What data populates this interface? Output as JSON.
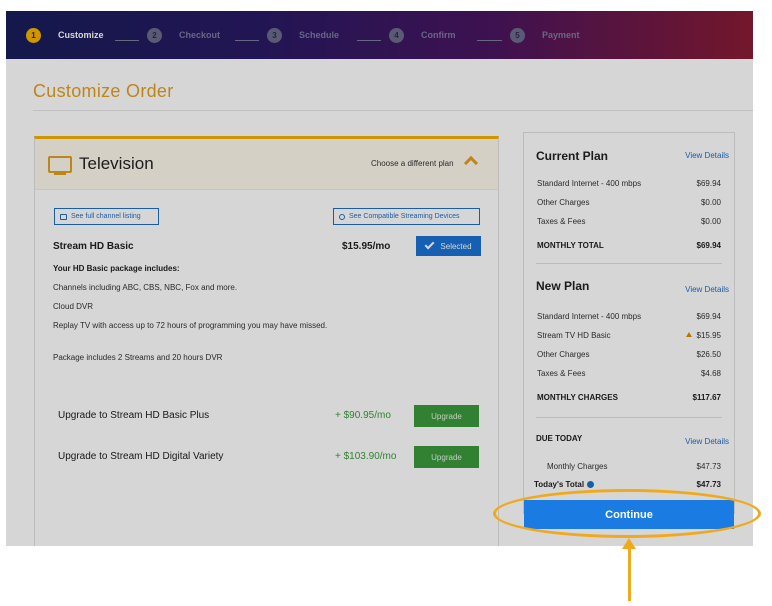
{
  "stepper": {
    "steps": [
      {
        "num": "1",
        "label": "Customize"
      },
      {
        "num": "2",
        "label": "Checkout"
      },
      {
        "num": "3",
        "label": "Schedule"
      },
      {
        "num": "4",
        "label": "Confirm"
      },
      {
        "num": "5",
        "label": "Payment"
      }
    ]
  },
  "page_title": "Customize Order",
  "television": {
    "title": "Television",
    "change_plan_label": "Choose a different plan",
    "channel_listing_label": "See full channel listing",
    "devices_label": "See Compatible Streaming Devices",
    "plan_name": "Stream HD Basic",
    "plan_price": "$15.95/mo",
    "selected_label": "Selected",
    "includes_title": "Your HD Basic package includes:",
    "includes": [
      "Channels including ABC, CBS, NBC, Fox and more.",
      "Cloud DVR",
      "Replay TV with access up to 72 hours of programming you may have missed.",
      "Package includes 2 Streams and 20 hours DVR"
    ],
    "upgrades": [
      {
        "name": "Upgrade to Stream HD Basic Plus",
        "price": "+ $90.95/mo",
        "button": "Upgrade"
      },
      {
        "name": "Upgrade to Stream HD Digital Variety",
        "price": "+ $103.90/mo",
        "button": "Upgrade"
      }
    ]
  },
  "summary": {
    "current": {
      "title": "Current Plan",
      "link": "View Details",
      "rows": [
        {
          "label": "Standard Internet - 400 mbps",
          "value": "$69.94"
        },
        {
          "label": "Other Charges",
          "value": "$0.00"
        },
        {
          "label": "Taxes & Fees",
          "value": "$0.00"
        }
      ],
      "total_label": "MONTHLY TOTAL",
      "total_value": "$69.94"
    },
    "new": {
      "title": "New Plan",
      "link": "View Details",
      "rows": [
        {
          "label": "Standard Internet - 400 mbps",
          "value": "$69.94"
        },
        {
          "label": "Stream TV HD Basic",
          "value": "$15.95"
        },
        {
          "label": "Other Charges",
          "value": "$26.50"
        },
        {
          "label": "Taxes & Fees",
          "value": "$4.68"
        }
      ],
      "total_label": "MONTHLY CHARGES",
      "total_value": "$117.67"
    },
    "due": {
      "title": "DUE TODAY",
      "link": "View Details",
      "rows": [
        {
          "label": "Monthly Charges",
          "value": "$47.73"
        }
      ],
      "total_label": "Today's Total",
      "total_value": "$47.73"
    }
  },
  "continue_label": "Continue",
  "colors": {
    "accent": "#f4b400",
    "primary": "#1a73d4",
    "upgrade": "#3c9a3c",
    "annotation": "#f0a91b"
  }
}
